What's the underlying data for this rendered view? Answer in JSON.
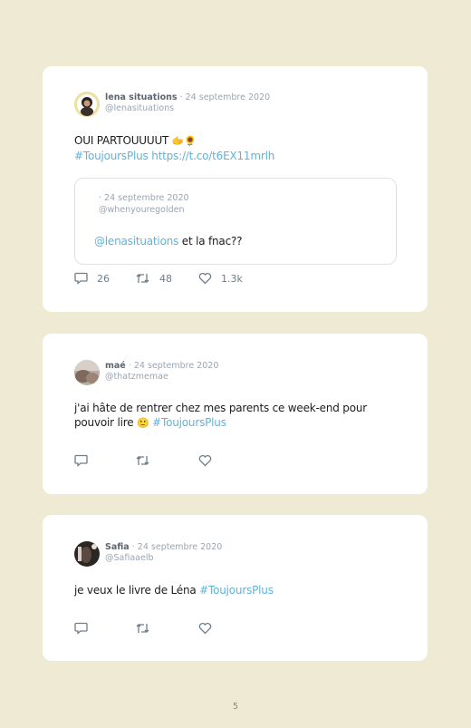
{
  "tweets": [
    {
      "name": "lena situations",
      "date": "· 24 septembre 2020",
      "handle": "@lenasituations",
      "text_line1": "OUI PARTOUUUUT",
      "emoji1": "🫱",
      "emoji2": "🌻",
      "hashtag": "#ToujoursPlus",
      "link": "https://t.co/t6EX11mrlh",
      "quote": {
        "date": "· 24 septembre 2020",
        "handle": "@whenyouregolden",
        "mention": "@lenasituations",
        "text": " et la fnac??"
      },
      "replies": "26",
      "retweets": "48",
      "likes": "1.3k"
    },
    {
      "name": "maé",
      "date": "· 24 septembre 2020",
      "handle": "@thatzmemae",
      "text_line1": "j'ai hâte de rentrer chez mes parents ce week-end pour",
      "text_line2": "pouvoir lire ",
      "emoji": "🙂",
      "hashtag": "#ToujoursPlus"
    },
    {
      "name": "Safia",
      "date": "· 24 septembre 2020",
      "handle": "@Safiaaelb",
      "text": "je veux le livre de Léna ",
      "hashtag": "#ToujoursPlus"
    }
  ],
  "page_number": "5",
  "colors": {
    "background": "#eeead4",
    "card": "#ffffff",
    "link": "#5fb3d9",
    "muted": "#9aa5b1"
  },
  "icons": [
    "reply-icon",
    "retweet-icon",
    "like-icon"
  ]
}
